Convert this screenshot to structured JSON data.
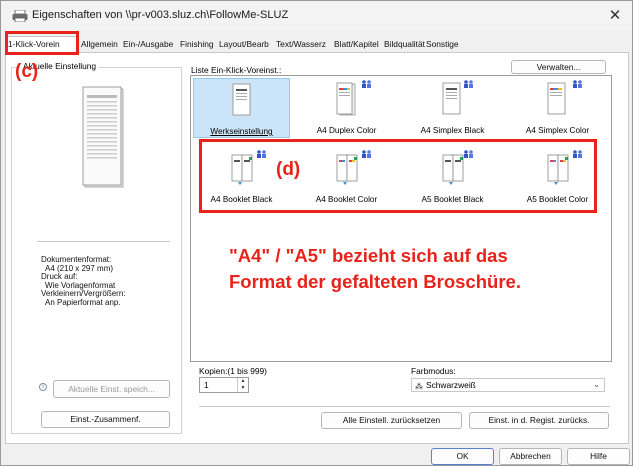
{
  "window": {
    "title": "Eigenschaften von \\\\pr-v003.sluz.ch\\FollowMe-SLUZ",
    "close_glyph": "✕"
  },
  "tabs": [
    {
      "label": "1-Klick-Vorein",
      "active": true
    },
    {
      "label": "Allgemein"
    },
    {
      "label": "Ein-/Ausgabe"
    },
    {
      "label": "Finishing"
    },
    {
      "label": "Layout/Bearb"
    },
    {
      "label": "Text/Wasserz"
    },
    {
      "label": "Blatt/Kapitel"
    },
    {
      "label": "Bildqualität"
    },
    {
      "label": "Sonstige"
    }
  ],
  "left_panel": {
    "group_label": "Aktuelle Einstellung",
    "info": {
      "doc_format_label": "Dokumentenformat:",
      "doc_format_value": "A4 (210 x 297 mm)",
      "print_on_label": "Druck auf:",
      "print_on_value": "Wie Vorlagenformat",
      "zoom_label": "Verkleinern/Vergrößern:",
      "zoom_value": "An Papierformat anp."
    },
    "save_button": "Aktuelle Einst. speich...",
    "summary_button": "Einst.-Zusammenf.",
    "info_glyph": "i"
  },
  "preset_list": {
    "label": "Liste Ein-Klick-Voreinst.:",
    "manage_button": "Verwalten...",
    "items": [
      {
        "label": "Werkseinstellung",
        "selected": true,
        "kind": "simplex-black",
        "shared": false
      },
      {
        "label": "A4 Duplex Color",
        "kind": "duplex-color",
        "shared": true
      },
      {
        "label": "A4 Simplex Black",
        "kind": "simplex-black",
        "shared": true
      },
      {
        "label": "A4 Simplex Color",
        "kind": "simplex-color",
        "shared": true
      },
      {
        "label": "A4 Booklet Black",
        "kind": "booklet-black",
        "shared": true
      },
      {
        "label": "A4 Booklet Color",
        "kind": "booklet-color",
        "shared": true
      },
      {
        "label": "A5 Booklet Black",
        "kind": "booklet-black",
        "shared": true
      },
      {
        "label": "A5 Booklet Color",
        "kind": "booklet-color",
        "shared": true
      }
    ]
  },
  "annotations": {
    "c_marker": "(c)",
    "d_marker": "(d)",
    "note_line1": "\"A4\" / \"A5\" bezieht sich auf das",
    "note_line2": "Format der gefalteten Broschüre.",
    "color": "#e8231b"
  },
  "copies": {
    "label": "Kopien:(1 bis 999)",
    "value": "1"
  },
  "color_mode": {
    "label": "Farbmodus:",
    "value": "Schwarzweiß"
  },
  "buttons": {
    "reset_all": "Alle Einstell. zurücksetzen",
    "reset_registry": "Einst. in d. Regist. zurücks.",
    "ok": "OK",
    "cancel": "Abbrechen",
    "help": "Hilfe"
  }
}
